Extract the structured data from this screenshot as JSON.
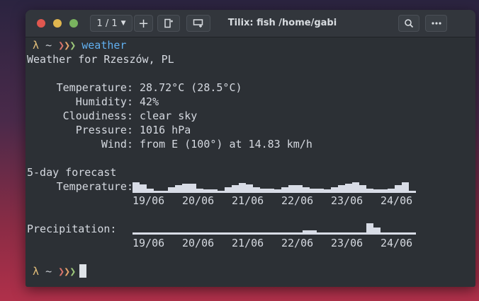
{
  "titlebar": {
    "sessions_label": "1 / 1",
    "plus_label": "+",
    "window_title": "Tilix: fish /home/gabi"
  },
  "prompt": {
    "lambda": "λ",
    "tilde": "~",
    "chevron1": "❯",
    "chevron2": "❯",
    "chevron3": "❯"
  },
  "command": "weather",
  "weather": {
    "header": "Weather for Rzeszów, PL",
    "rows": [
      {
        "label": "Temperature:",
        "value": "28.72°C (28.5°C)"
      },
      {
        "label": "Humidity:",
        "value": "42%"
      },
      {
        "label": "Cloudiness:",
        "value": "clear sky"
      },
      {
        "label": "Pressure:",
        "value": "1016 hPa"
      },
      {
        "label": "Wind:",
        "value": "from E (100°) at 14.83 km/h"
      }
    ]
  },
  "forecast": {
    "title": "5-day forecast",
    "temperature_label": "Temperature:",
    "precipitation_label": "Precipitation:",
    "dates": [
      "19/06",
      "20/06",
      "21/06",
      "22/06",
      "23/06",
      "24/06"
    ],
    "temperature_levels": [
      0.85,
      0.65,
      0.35,
      0.15,
      0.15,
      0.45,
      0.6,
      0.7,
      0.7,
      0.35,
      0.25,
      0.25,
      0.15,
      0.45,
      0.6,
      0.8,
      0.65,
      0.45,
      0.35,
      0.35,
      0.25,
      0.45,
      0.6,
      0.6,
      0.45,
      0.35,
      0.35,
      0.25,
      0.45,
      0.6,
      0.7,
      0.85,
      0.6,
      0.35,
      0.25,
      0.25,
      0.35,
      0.6,
      0.85,
      0.15
    ],
    "precipitation_levels": [
      0,
      0,
      0,
      0,
      0,
      0,
      0,
      0,
      0,
      0,
      0,
      0,
      0,
      0,
      0,
      0,
      0,
      0,
      0,
      0,
      0,
      0,
      0,
      0,
      0.35,
      0.35,
      0,
      0,
      0,
      0,
      0,
      0,
      0,
      1.0,
      0.6,
      0,
      0,
      0,
      0,
      0
    ]
  }
}
